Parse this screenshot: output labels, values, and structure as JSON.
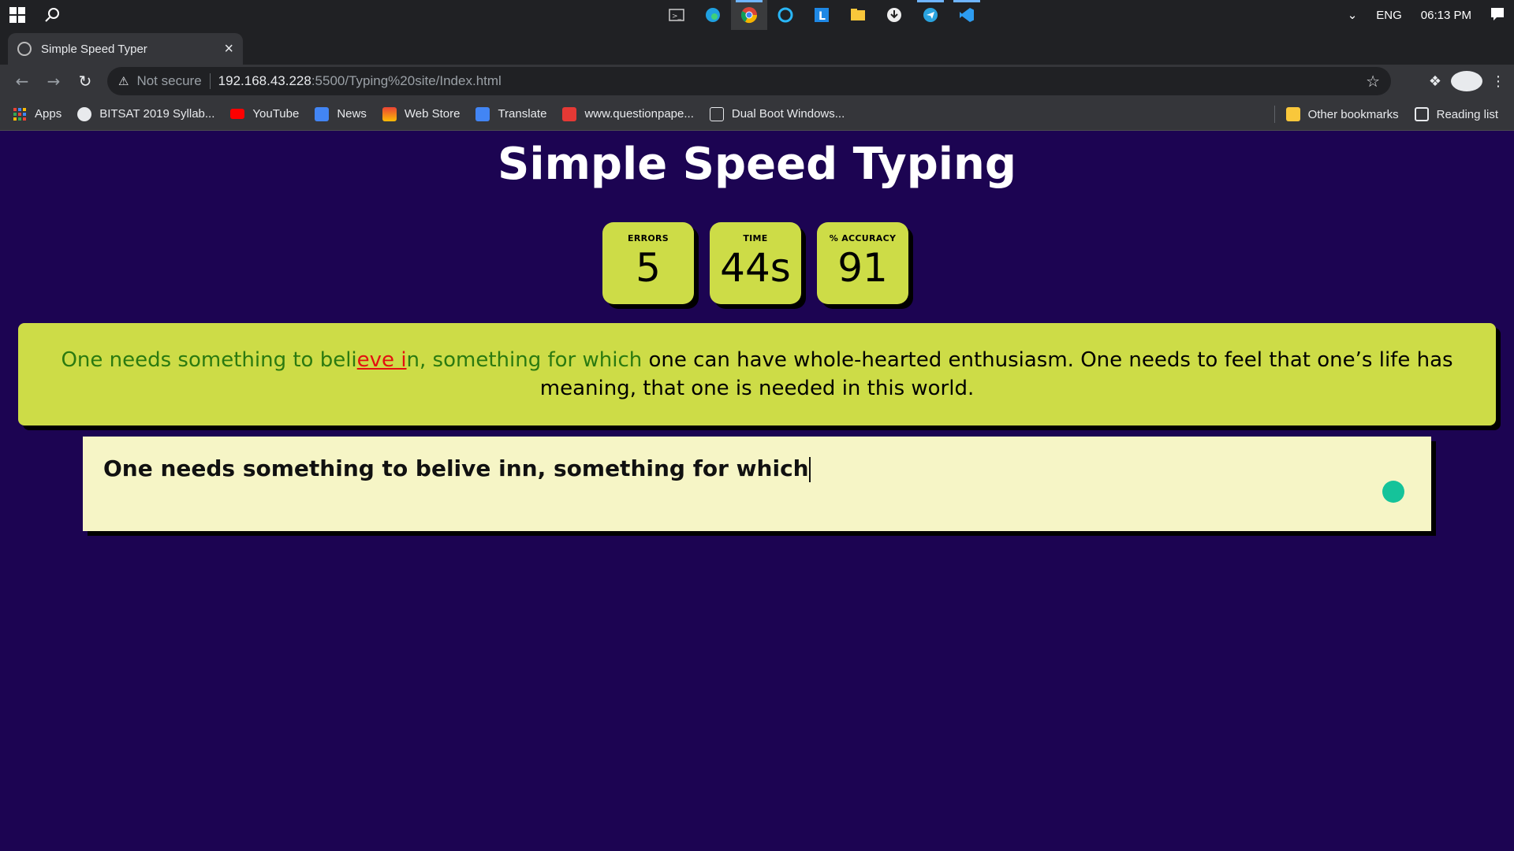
{
  "taskbar": {
    "lang": "ENG",
    "time": "06:13 PM"
  },
  "browser": {
    "tab_title": "Simple Speed Typer",
    "not_secure": "Not secure",
    "url_host": "192.168.43.228",
    "url_path": ":5500/Typing%20site/Index.html"
  },
  "bookmarks": {
    "items": [
      "Apps",
      "BITSAT 2019 Syllab...",
      "YouTube",
      "News",
      "Web Store",
      "Translate",
      "www.questionpape...",
      "Dual Boot Windows..."
    ],
    "other": "Other bookmarks",
    "reading_list": "Reading list"
  },
  "page": {
    "heading": "Simple Speed Typing",
    "stats": {
      "errors_label": "ERRORS",
      "errors_value": "5",
      "time_label": "TIME",
      "time_value": "44s",
      "accuracy_label": "% ACCURACY",
      "accuracy_value": "91"
    },
    "quote": {
      "correct_1": "One needs something to beli",
      "incorrect": "eve i",
      "correct_2": "n, something for which",
      "remaining": " one can have whole-hearted enthusiasm. One needs to feel that one’s life has meaning, that one is needed in this world."
    },
    "typed_text": "One needs something to belive inn, something for which"
  },
  "colors": {
    "background": "#1c0452",
    "card": "#cddc47",
    "correct": "#2b7a10",
    "incorrect": "#e31010",
    "input": "#f6f5c6"
  }
}
